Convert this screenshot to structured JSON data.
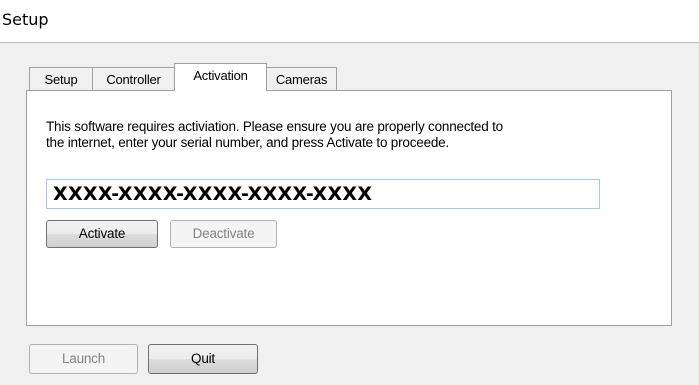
{
  "window": {
    "title": "Setup"
  },
  "tabs": [
    {
      "label": "Setup",
      "active": false
    },
    {
      "label": "Controller",
      "active": false
    },
    {
      "label": "Activation",
      "active": true
    },
    {
      "label": "Cameras",
      "active": false
    }
  ],
  "activation": {
    "description_line1": "This software requires activiation. Please ensure you are properly connected to",
    "description_line2": "the internet, enter your serial number, and press Activate to proceede.",
    "serial_value": "XXXX-XXXX-XXXX-XXXX-XXXX",
    "activate_label": "Activate",
    "deactivate_label": "Deactivate",
    "deactivate_enabled": false
  },
  "footer": {
    "launch_label": "Launch",
    "launch_enabled": false,
    "quit_label": "Quit"
  },
  "colors": {
    "window_bg": "#f0f0f0",
    "panel_bg": "#ffffff",
    "border": "#a0a0a0",
    "input_border": "#a6c8e8",
    "disabled_text": "#838383"
  }
}
